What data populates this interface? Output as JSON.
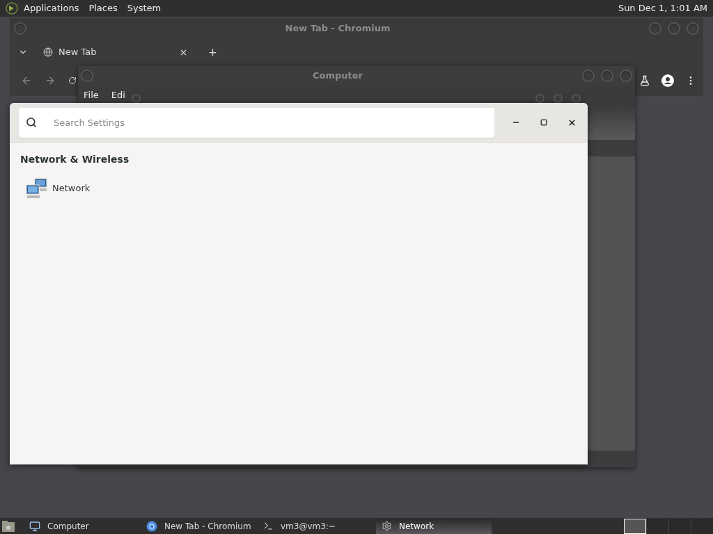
{
  "top_panel": {
    "menus": [
      "Applications",
      "Places",
      "System"
    ],
    "clock": "Sun Dec 1, 1:01 AM"
  },
  "browser_window": {
    "title": "New Tab - Chromium",
    "tabs": [
      {
        "label": "New Tab"
      }
    ]
  },
  "file_window": {
    "title": "Computer",
    "menus": [
      "File",
      "Edi"
    ]
  },
  "settings_window": {
    "search": {
      "placeholder": "Search Settings"
    },
    "sections": [
      {
        "heading": "Network & Wireless",
        "items": [
          {
            "label": "Network"
          }
        ]
      }
    ]
  },
  "taskbar": {
    "items": [
      {
        "label": "Computer",
        "kind": "computer",
        "selected": false
      },
      {
        "label": "New Tab - Chromium",
        "kind": "browser",
        "selected": false
      },
      {
        "label": "vm3@vm3:~",
        "kind": "terminal",
        "selected": false
      },
      {
        "label": "Network",
        "kind": "settings",
        "selected": true
      }
    ],
    "workspaces": [
      {
        "selected": true
      },
      {
        "selected": false
      },
      {
        "selected": false
      },
      {
        "selected": false
      }
    ]
  }
}
